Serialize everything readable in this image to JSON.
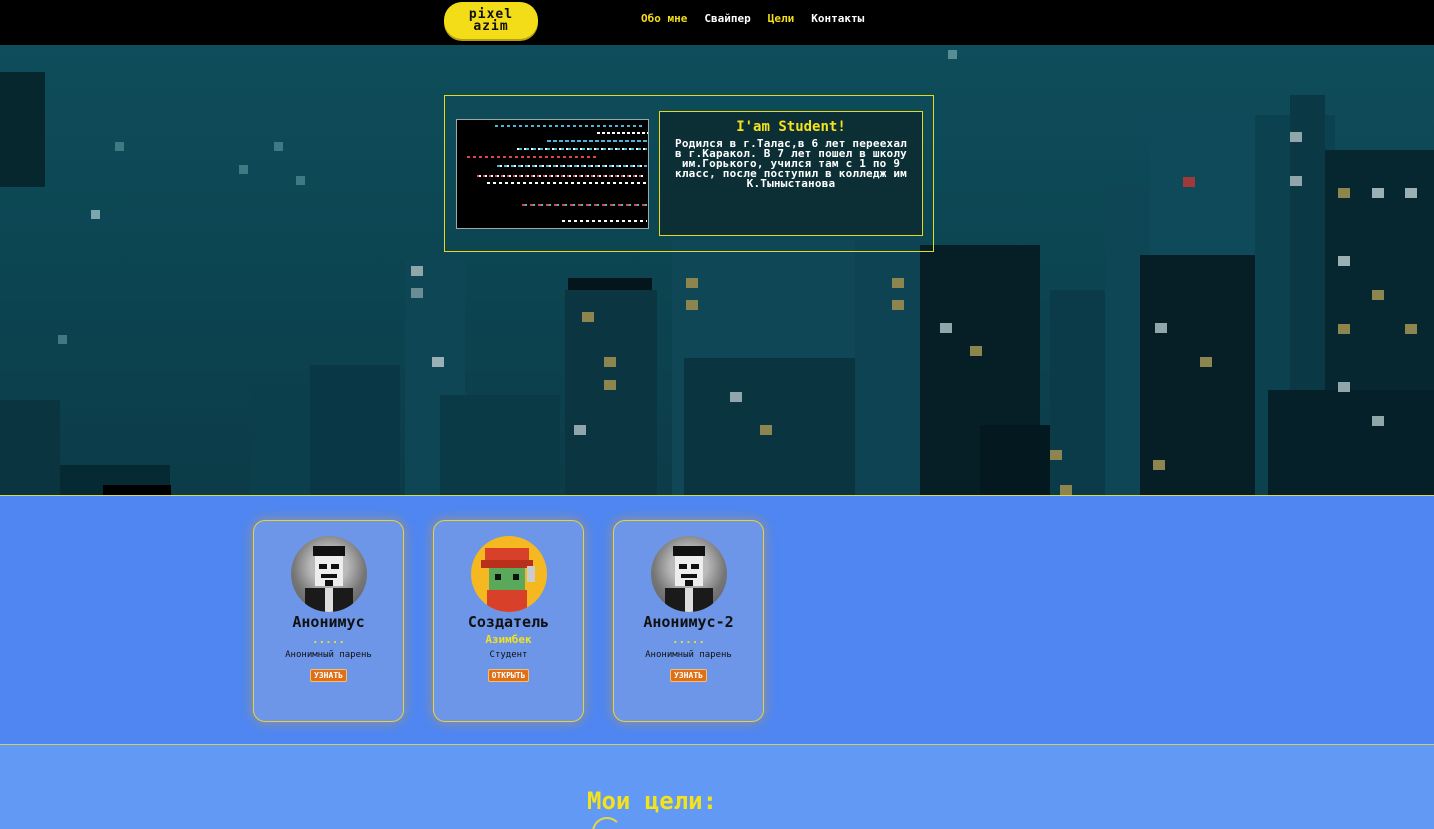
{
  "nav": {
    "logo_line1": "pixel",
    "logo_line2": "azim",
    "links": [
      {
        "label": "Обо мне",
        "active": true
      },
      {
        "label": "Свайпер",
        "active": false
      },
      {
        "label": "Цели",
        "active": true
      },
      {
        "label": "Контакты",
        "active": false
      }
    ]
  },
  "about": {
    "title": "I'am Student!",
    "body": "Родился в г.Талас,в 6 лет переехал в г.Каракол. В 7 лет пошел в школу им.Горького, учился там с 1 по 9 класс, после поступил в колледж им К.Тыныстанова"
  },
  "team": {
    "cards": [
      {
        "name": "Анонимус",
        "subtitle": ".....",
        "description": "Анонимный парень",
        "button": "УЗНАТЬ",
        "avatar": "anonymous-avatar"
      },
      {
        "name": "Создатель",
        "subtitle": "Азимбек",
        "description": "Студент",
        "button": "ОТКРЫТЬ",
        "avatar": "pixel-mario-avatar"
      },
      {
        "name": "Анонимус-2",
        "subtitle": ".....",
        "description": "Анонимный парень",
        "button": "УЗНАТЬ",
        "avatar": "anonymous-avatar"
      }
    ]
  },
  "goals": {
    "title": "Мои цели:"
  },
  "colors": {
    "accent": "#f3dd18",
    "nav_bg": "#000000",
    "hero_bg": "#0d4a58",
    "team_bg": "#4f86f2",
    "button": "#e07018"
  }
}
